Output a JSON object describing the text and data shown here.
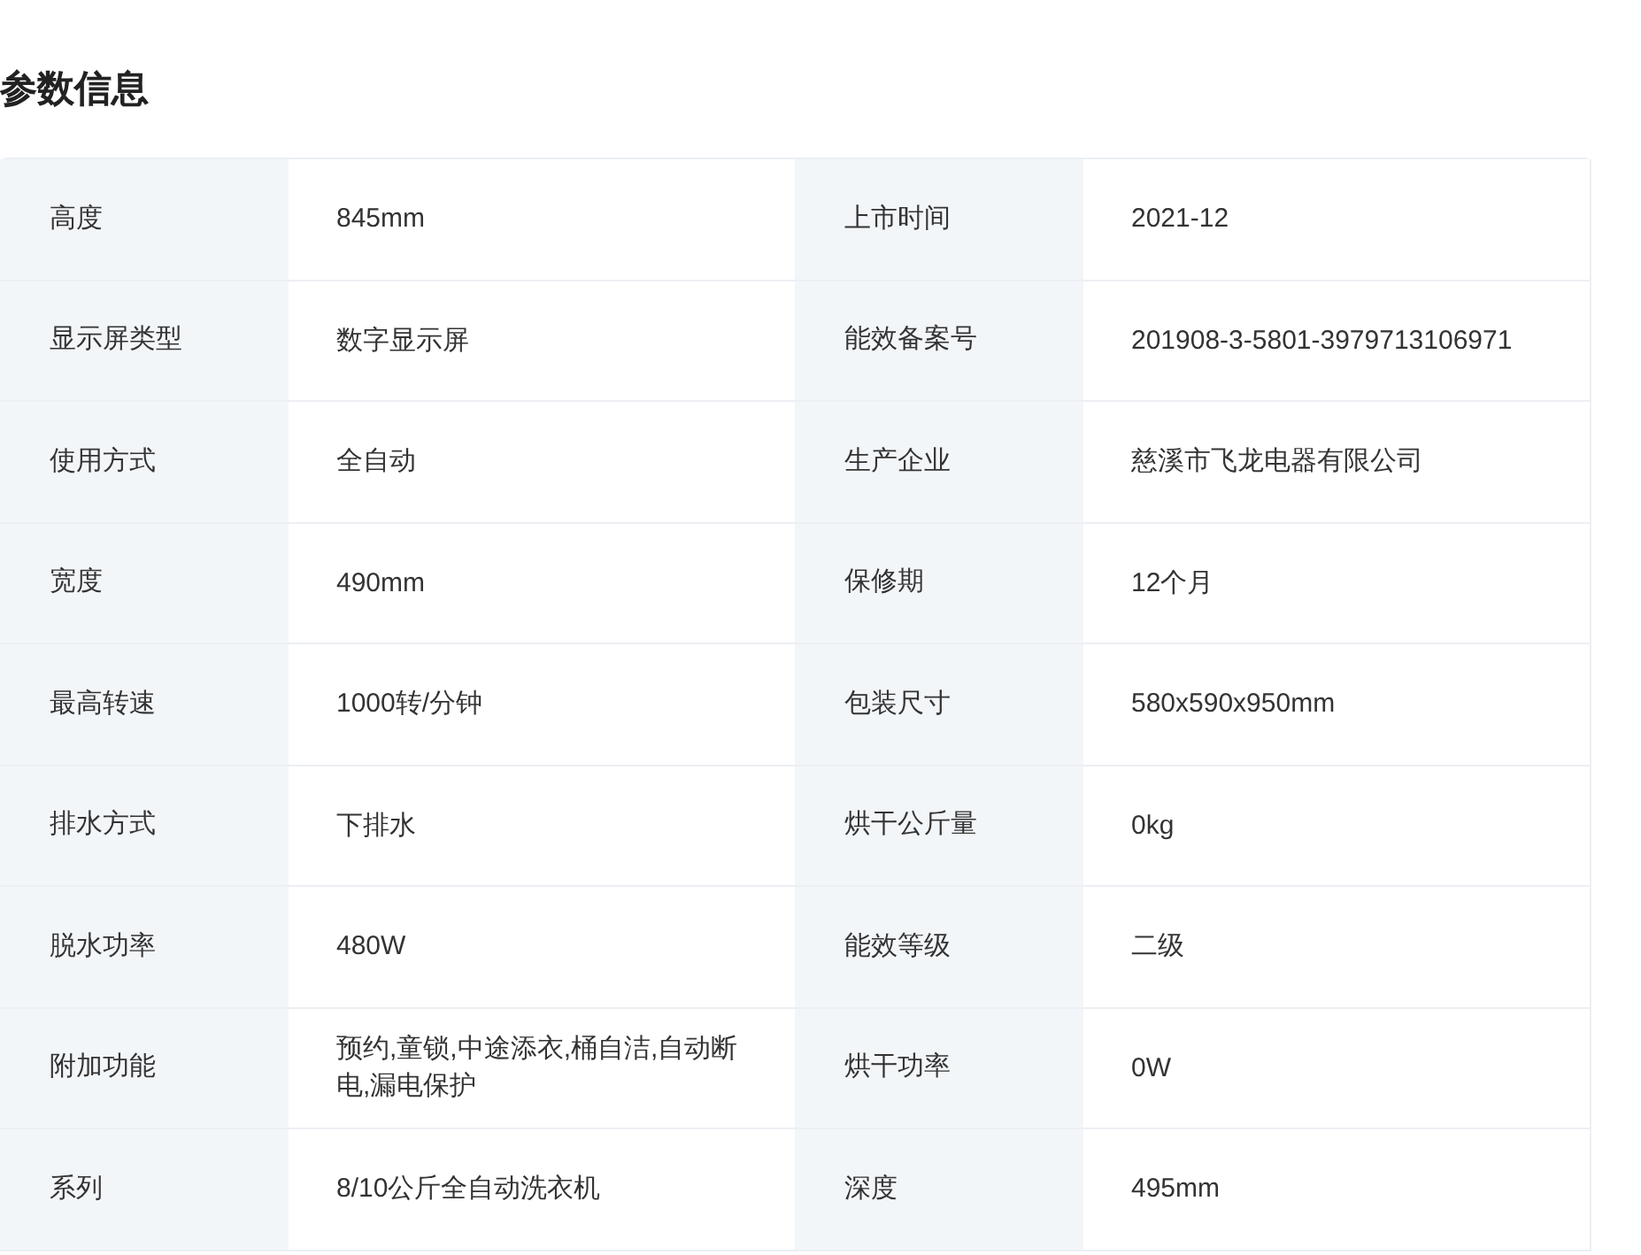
{
  "title": "参数信息",
  "rows": [
    {
      "left": {
        "label": "高度",
        "value": "845mm"
      },
      "right": {
        "label": "上市时间",
        "value": "2021-12"
      }
    },
    {
      "left": {
        "label": "显示屏类型",
        "value": "数字显示屏"
      },
      "right": {
        "label": "能效备案号",
        "value": "201908-3-5801-3979713106971"
      }
    },
    {
      "left": {
        "label": "使用方式",
        "value": "全自动"
      },
      "right": {
        "label": "生产企业",
        "value": "慈溪市飞龙电器有限公司"
      }
    },
    {
      "left": {
        "label": "宽度",
        "value": "490mm"
      },
      "right": {
        "label": "保修期",
        "value": "12个月"
      }
    },
    {
      "left": {
        "label": "最高转速",
        "value": "1000转/分钟"
      },
      "right": {
        "label": "包装尺寸",
        "value": "580x590x950mm"
      }
    },
    {
      "left": {
        "label": "排水方式",
        "value": "下排水"
      },
      "right": {
        "label": "烘干公斤量",
        "value": "0kg"
      }
    },
    {
      "left": {
        "label": "脱水功率",
        "value": "480W"
      },
      "right": {
        "label": "能效等级",
        "value": "二级"
      }
    },
    {
      "left": {
        "label": "附加功能",
        "value": "预约,童锁,中途添衣,桶自洁,自动断电,漏电保护"
      },
      "right": {
        "label": "烘干功率",
        "value": "0W"
      }
    },
    {
      "left": {
        "label": "系列",
        "value": "8/10公斤全自动洗衣机"
      },
      "right": {
        "label": "深度",
        "value": "495mm"
      }
    }
  ]
}
